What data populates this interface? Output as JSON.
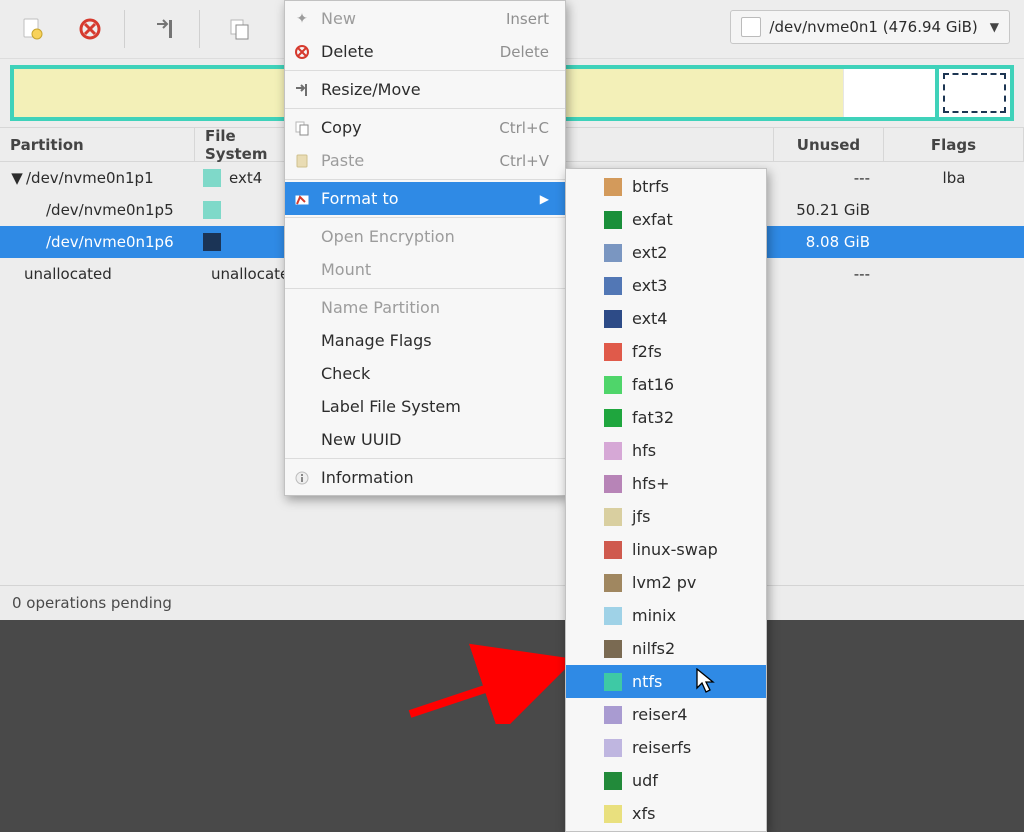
{
  "toolbar": {
    "device_label": "/dev/nvme0n1 (476.94 GiB)"
  },
  "columns": {
    "partition": "Partition",
    "filesystem": "File System",
    "unused": "Unused",
    "flags": "Flags"
  },
  "rows": {
    "r0": {
      "name": "/dev/nvme0n1p1",
      "fs": "ext4",
      "unused": "---",
      "flags": "lba"
    },
    "r1": {
      "name": "/dev/nvme0n1p5",
      "fs": "",
      "unused": "50.21 GiB",
      "flags": ""
    },
    "r2": {
      "name": "/dev/nvme0n1p6",
      "fs": "",
      "unused": "8.08 GiB",
      "flags": ""
    },
    "r3": {
      "name": "unallocated",
      "fs": "unallocated",
      "unused": "---",
      "flags": ""
    }
  },
  "menu": {
    "new": "New",
    "new_accel": "Insert",
    "delete": "Delete",
    "delete_accel": "Delete",
    "resize": "Resize/Move",
    "copy": "Copy",
    "copy_accel": "Ctrl+C",
    "paste": "Paste",
    "paste_accel": "Ctrl+V",
    "format": "Format to",
    "open_enc": "Open Encryption",
    "mount": "Mount",
    "name_part": "Name Partition",
    "manage_flags": "Manage Flags",
    "check": "Check",
    "label_fs": "Label File System",
    "new_uuid": "New UUID",
    "info": "Information"
  },
  "fs": {
    "btrfs": "btrfs",
    "exfat": "exfat",
    "ext2": "ext2",
    "ext3": "ext3",
    "ext4": "ext4",
    "f2fs": "f2fs",
    "fat16": "fat16",
    "fat32": "fat32",
    "hfs": "hfs",
    "hfsplus": "hfs+",
    "jfs": "jfs",
    "linuxswap": "linux-swap",
    "lvm2": "lvm2 pv",
    "minix": "minix",
    "nilfs2": "nilfs2",
    "ntfs": "ntfs",
    "reiser4": "reiser4",
    "reiserfs": "reiserfs",
    "udf": "udf",
    "xfs": "xfs"
  },
  "status": {
    "pending": "0 operations pending"
  }
}
